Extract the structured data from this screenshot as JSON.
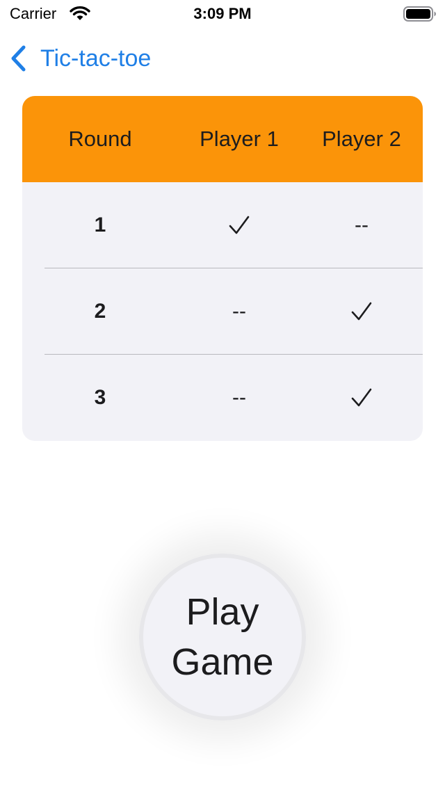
{
  "status_bar": {
    "carrier": "Carrier",
    "time": "3:09 PM"
  },
  "nav": {
    "back_label": "Tic-tac-toe"
  },
  "score_table": {
    "headers": [
      "Round",
      "Player 1",
      "Player 2"
    ],
    "rows": [
      {
        "round": "1",
        "player1": "check",
        "player2": "--"
      },
      {
        "round": "2",
        "player1": "--",
        "player2": "check"
      },
      {
        "round": "3",
        "player1": "--",
        "player2": "check"
      }
    ]
  },
  "play_button": {
    "line1": "Play",
    "line2": "Game"
  },
  "colors": {
    "accent_blue": "#1f7fe6",
    "header_orange": "#fb9409",
    "table_bg": "#f2f2f7"
  },
  "icons": {
    "back": "chevron-left-icon",
    "wifi": "wifi-icon",
    "battery": "battery-icon",
    "win": "checkmark-icon"
  }
}
